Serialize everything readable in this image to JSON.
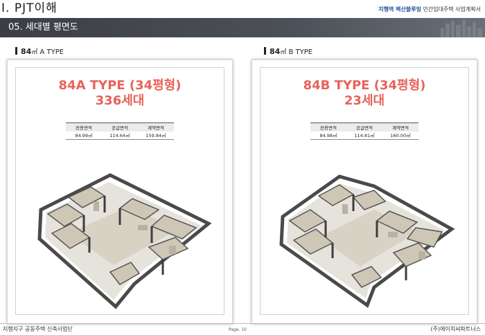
{
  "top": {
    "title": "Ⅰ. PJT이해",
    "right_blue": "지행역 벽산블루밍",
    "right_gray": "민간임대주택 사업계획서"
  },
  "header": {
    "section_title": "05. 세대별 평면도"
  },
  "units": [
    {
      "type_label_size": "84",
      "type_label_unit": "㎡",
      "type_label_name": "A TYPE",
      "title": "84A TYPE (34평형)",
      "households": "336세대",
      "spec_headers": [
        "전용면적",
        "공급면적",
        "계약면적"
      ],
      "spec_values": [
        "84.99㎡",
        "114.64㎡",
        "159.84㎡"
      ]
    },
    {
      "type_label_size": "84",
      "type_label_unit": "㎡",
      "type_label_name": "B TYPE",
      "title": "84B TYPE (34평형)",
      "households": "23세대",
      "spec_headers": [
        "전용면적",
        "공급면적",
        "계약면적"
      ],
      "spec_values": [
        "84.98㎡",
        "114.81㎡",
        "160.00㎡"
      ]
    }
  ],
  "footer": {
    "left": "지행지구 공동주택 신축사업단",
    "center": "Page. 10",
    "right": "(주)에이치씨파트너스"
  },
  "colors": {
    "accent": "#e8625a",
    "header_bg": "#4a4d55",
    "brand_blue": "#1f4e9c"
  }
}
